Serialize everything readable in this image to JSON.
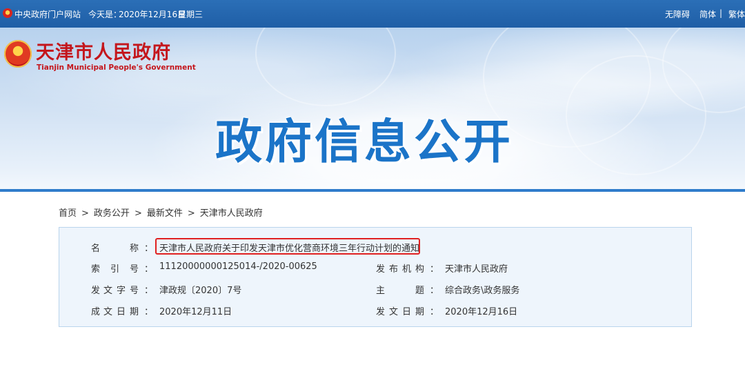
{
  "topbar": {
    "site_link": "中央政府门户网站",
    "date_label": "今天是：",
    "date_value": "2020年12月16日",
    "weekday": "星期三",
    "accessible": "无障碍",
    "simplified": "简体",
    "separator": "|",
    "traditional": "繁体"
  },
  "banner": {
    "logo_cn": "天津市人民政府",
    "logo_en": "Tianjin Municipal People's Government",
    "title": "政府信息公开"
  },
  "breadcrumb": {
    "items": [
      "首页",
      "政务公开",
      "最新文件",
      "天津市人民政府"
    ],
    "arrow": ">"
  },
  "info": {
    "name_label": [
      "名",
      "称"
    ],
    "name_value": "天津市人民政府关于印发天津市优化营商环境三年行动计划的通知",
    "index_label": [
      "索",
      "引",
      "号"
    ],
    "index_value": "11120000000125014-/2020-00625",
    "issuer_label": [
      "发",
      "布",
      "机",
      "构"
    ],
    "issuer_value": "天津市人民政府",
    "docno_label": [
      "发",
      "文",
      "字",
      "号"
    ],
    "docno_value": "津政规〔2020〕7号",
    "topic_label": [
      "主",
      "题"
    ],
    "topic_value": "综合政务\\政务服务",
    "created_label": [
      "成",
      "文",
      "日",
      "期"
    ],
    "created_value": "2020年12月11日",
    "published_label": [
      "发",
      "文",
      "日",
      "期"
    ],
    "published_value": "2020年12月16日",
    "colon": "："
  },
  "colors": {
    "topbar": "#2468b0",
    "title_blue": "#1b74c8",
    "logo_red": "#c4161c",
    "highlight": "#e02020",
    "infobox_bg": "#eef5fc"
  }
}
